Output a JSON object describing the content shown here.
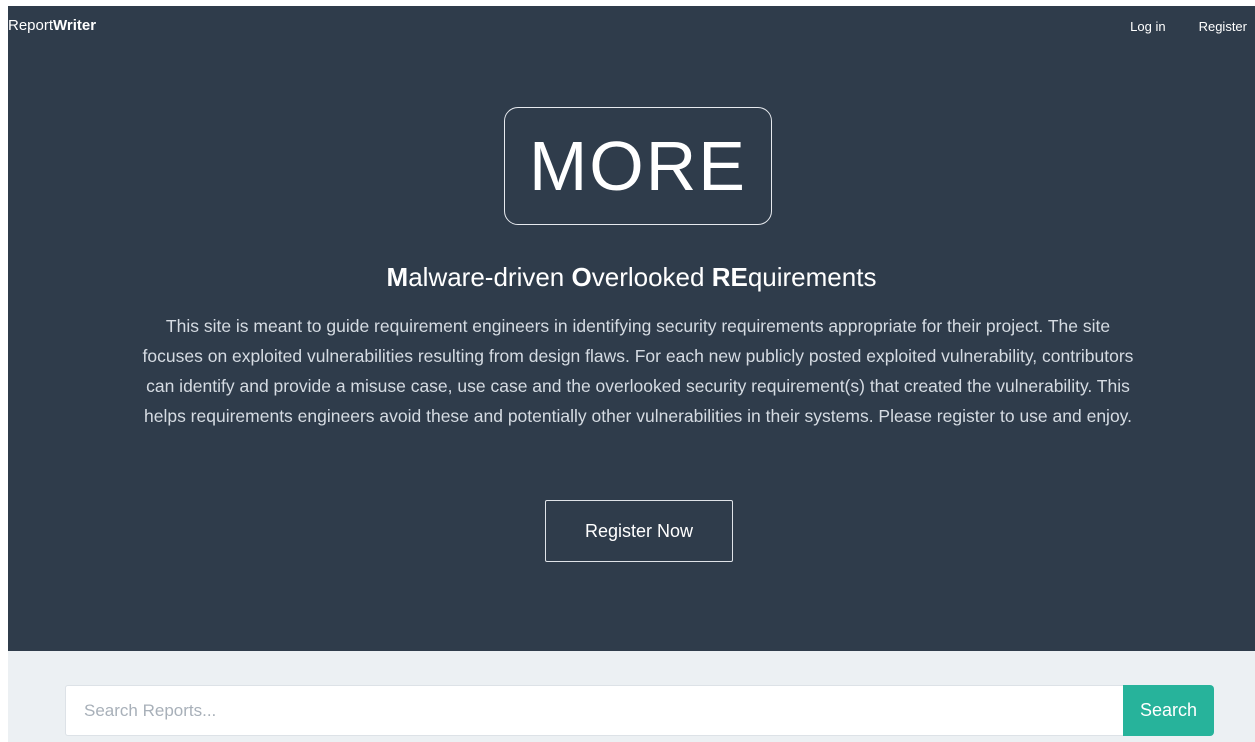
{
  "nav": {
    "brand_regular": "Report",
    "brand_bold": "Writer",
    "login": "Log in",
    "register": "Register"
  },
  "hero": {
    "logo_text": "MORE",
    "headline": {
      "m_bold": "M",
      "m_rest": "alware-driven ",
      "o_bold": "O",
      "o_rest": "verlooked ",
      "re_bold": "RE",
      "re_rest": "quirements"
    },
    "description": "This site is meant to guide requirement engineers in identifying security requirements appropriate for their project. The site focuses on exploited vulnerabilities resulting from design flaws. For each new publicly posted exploited vulnerability, contributors can identify and provide a misuse case, use case and the overlooked security requirement(s) that created the vulnerability. This helps requirements engineers avoid these and potentially other vulnerabilities in their systems. Please register to use and enjoy.",
    "register_button": "Register Now",
    "background_color": "#2f3c4b"
  },
  "search": {
    "placeholder": "Search Reports...",
    "value": "",
    "button_label": "Search",
    "button_color": "#27b39b"
  }
}
